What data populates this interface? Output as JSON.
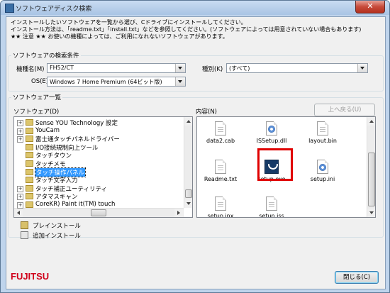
{
  "window": {
    "title": "ソフトウェアディスク検索"
  },
  "intro": {
    "line1": "インストールしたいソフトウェアを一覧から選び、Cドライブにインストールしてください。",
    "line2": "インストール方法は、「readme.txt」「install.txt」などを参照してください。(ソフトウェアによっては用意されていない場合もあります)",
    "line3": "★★ 注意 ★★ お使いの機種によっては、ご利用になれないソフトウェアがあります。"
  },
  "search": {
    "legend": "ソフトウェアの検索条件",
    "model_label": "機種名(M)",
    "model_value": "FH52/CT",
    "type_label": "種別(K)",
    "type_value": "(すべて)",
    "os_label": "OS(E)",
    "os_value": "Windows 7 Home Premium (64ビット版)"
  },
  "list": {
    "legend": "ソフトウェア一覧",
    "software_label": "ソフトウェア(D)",
    "content_label": "内容(N)",
    "up_button": "上へ戻る(U)",
    "tree": [
      {
        "label": "Sense YOU Technology 設定",
        "expandable": true,
        "selected": false
      },
      {
        "label": "YouCam",
        "expandable": true,
        "selected": false
      },
      {
        "label": "富士通タッチパネルドライバー",
        "expandable": true,
        "selected": false
      },
      {
        "label": "I/O接続規制向上ツール",
        "expandable": false,
        "selected": false
      },
      {
        "label": "タッチタウン",
        "expandable": false,
        "selected": false
      },
      {
        "label": "タッチメモ",
        "expandable": false,
        "selected": false
      },
      {
        "label": "タッチ操作パネル",
        "expandable": false,
        "selected": true
      },
      {
        "label": "タッチ文字入力",
        "expandable": false,
        "selected": false
      },
      {
        "label": "タッチ補正ユーティリティ",
        "expandable": true,
        "selected": false
      },
      {
        "label": "アタマスキャン",
        "expandable": true,
        "selected": false
      },
      {
        "label": "CoreKR) Paint it(TM) touch",
        "expandable": true,
        "selected": false
      }
    ],
    "files": [
      {
        "name": "data2.cab",
        "icon": "document-icon"
      },
      {
        "name": "ISSetup.dll",
        "icon": "dll-gear-icon"
      },
      {
        "name": "layout.bin",
        "icon": "document-icon"
      },
      {
        "name": "Readme.txt",
        "icon": "text-document-icon"
      },
      {
        "name": "setup.exe",
        "icon": "setup-exe-icon"
      },
      {
        "name": "setup.ini",
        "icon": "settings-file-icon"
      },
      {
        "name": "setup.inx",
        "icon": "document-icon"
      },
      {
        "name": "setup.iss",
        "icon": "document-icon"
      }
    ]
  },
  "legend_items": {
    "preinstall": "プレインストール",
    "additional": "追加インストール"
  },
  "footer": {
    "brand": "FUJITSU",
    "close_button": "閉じる(C)"
  },
  "colors": {
    "highlight": "#e00000",
    "selection": "#3399ff",
    "brand": "#d0021b"
  }
}
